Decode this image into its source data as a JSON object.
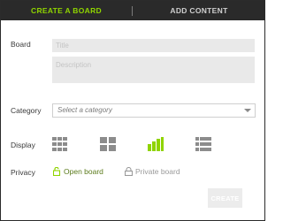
{
  "tabs": {
    "create_board": "CREATE A BOARD",
    "add_content": "ADD CONTENT",
    "active_color": "#8fd400"
  },
  "form": {
    "board_label": "Board",
    "title_placeholder": "Title",
    "description_placeholder": "Description",
    "category_label": "Category",
    "category_placeholder": "Select a category",
    "display_label": "Display",
    "display_options": [
      {
        "name": "grid-small-icon",
        "selected": false
      },
      {
        "name": "grid-large-icon",
        "selected": false
      },
      {
        "name": "bars-icon",
        "selected": true
      },
      {
        "name": "list-icon",
        "selected": false
      }
    ],
    "privacy_label": "Privacy",
    "open_board": "Open board",
    "private_board": "Private board",
    "privacy_selected": "open"
  },
  "actions": {
    "create_button": "CREATE"
  },
  "colors": {
    "accent": "#8fd400",
    "header_bg": "#2a2a2a",
    "icon_gray": "#8c8c8c"
  }
}
